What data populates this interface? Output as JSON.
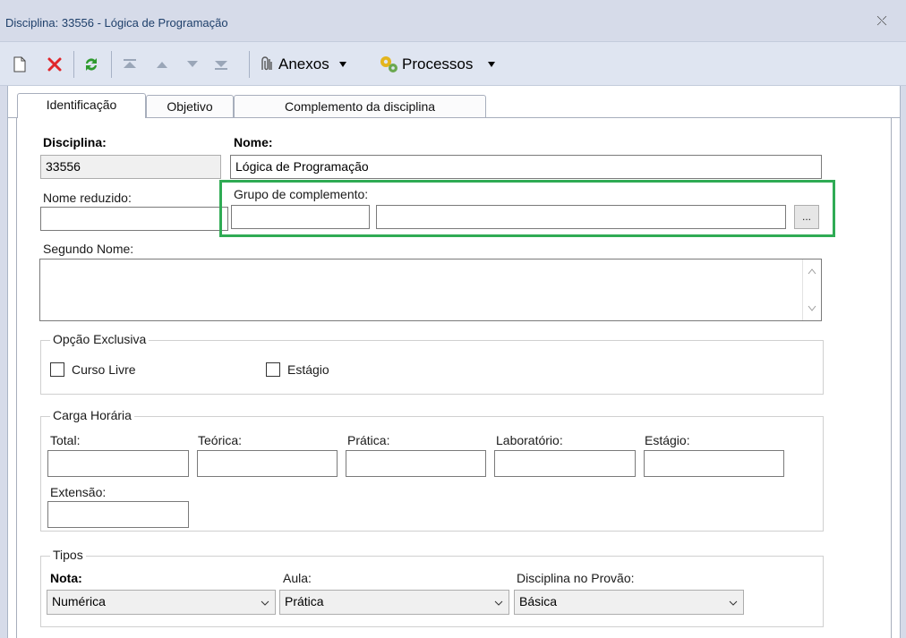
{
  "window": {
    "title": "Disciplina: 33556 - Lógica de Programação",
    "close_glyph": "⤬"
  },
  "toolbar": {
    "anexos_label": "Anexos",
    "processos_label": "Processos",
    "icons": [
      "new-document-icon",
      "delete-icon",
      "refresh-icon",
      "first-record-icon",
      "previous-record-icon",
      "next-record-icon",
      "last-record-icon",
      "paperclip-icon",
      "gear-process-icon"
    ]
  },
  "tabs": [
    {
      "label": "Identificação",
      "active": true
    },
    {
      "label": "Objetivo",
      "active": false
    },
    {
      "label": "Complemento da disciplina",
      "active": false
    }
  ],
  "form": {
    "disciplina": {
      "label": "Disciplina:",
      "value": "33556"
    },
    "nome": {
      "label": "Nome:",
      "value": "Lógica de Programação"
    },
    "nome_reduzido": {
      "label": "Nome reduzido:",
      "value": ""
    },
    "grupo_complemento": {
      "label": "Grupo de complemento:",
      "code": "",
      "description": "",
      "button": "..."
    },
    "segundo_nome": {
      "label": "Segundo Nome:",
      "value": ""
    }
  },
  "opcao_exclusiva": {
    "title": "Opção Exclusiva",
    "curso_livre": {
      "label": "Curso Livre",
      "checked": false
    },
    "estagio": {
      "label": "Estágio",
      "checked": false
    }
  },
  "carga_horaria": {
    "title": "Carga Horária",
    "total": {
      "label": "Total:",
      "value": ""
    },
    "teorica": {
      "label": "Teórica:",
      "value": ""
    },
    "pratica": {
      "label": "Prática:",
      "value": ""
    },
    "laboratorio": {
      "label": "Laboratório:",
      "value": ""
    },
    "estagio": {
      "label": "Estágio:",
      "value": ""
    },
    "extensao": {
      "label": "Extensão:",
      "value": ""
    }
  },
  "tipos": {
    "title": "Tipos",
    "nota": {
      "label": "Nota:",
      "value": "Numérica"
    },
    "aula": {
      "label": "Aula:",
      "value": "Prática"
    },
    "disciplina_provao": {
      "label": "Disciplina no Provão:",
      "value": "Básica"
    }
  },
  "colors": {
    "highlight": "#2fab54",
    "delete": "#e0262b",
    "refresh": "#2e9a2e"
  }
}
